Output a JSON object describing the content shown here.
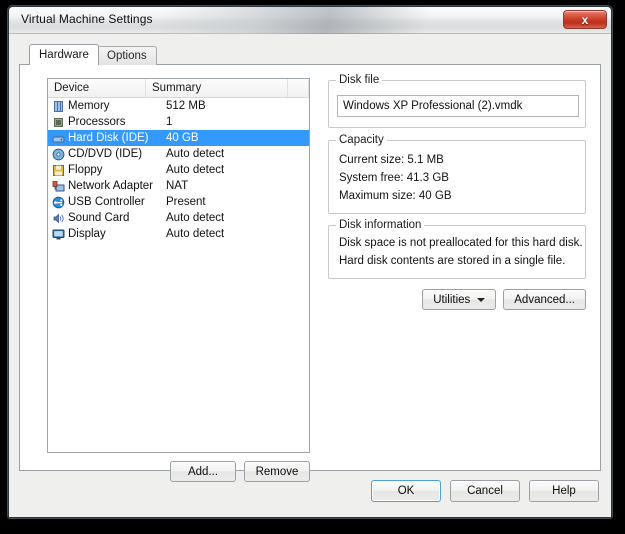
{
  "window": {
    "title": "Virtual Machine Settings",
    "close_label": "x"
  },
  "tabs": [
    {
      "label": "Hardware",
      "active": true
    },
    {
      "label": "Options",
      "active": false
    }
  ],
  "device_list": {
    "columns": [
      "Device",
      "Summary",
      ""
    ],
    "rows": [
      {
        "icon": "memory-icon",
        "device": "Memory",
        "summary": "512 MB",
        "selected": false
      },
      {
        "icon": "processor-icon",
        "device": "Processors",
        "summary": "1",
        "selected": false
      },
      {
        "icon": "hard-disk-icon",
        "device": "Hard Disk (IDE)",
        "summary": "40 GB",
        "selected": true
      },
      {
        "icon": "cd-dvd-icon",
        "device": "CD/DVD (IDE)",
        "summary": "Auto detect",
        "selected": false
      },
      {
        "icon": "floppy-icon",
        "device": "Floppy",
        "summary": "Auto detect",
        "selected": false
      },
      {
        "icon": "network-adapter-icon",
        "device": "Network Adapter",
        "summary": "NAT",
        "selected": false
      },
      {
        "icon": "usb-controller-icon",
        "device": "USB Controller",
        "summary": "Present",
        "selected": false
      },
      {
        "icon": "sound-card-icon",
        "device": "Sound Card",
        "summary": "Auto detect",
        "selected": false
      },
      {
        "icon": "display-icon",
        "device": "Display",
        "summary": "Auto detect",
        "selected": false
      }
    ],
    "add_label": "Add...",
    "remove_label": "Remove"
  },
  "disk_file": {
    "legend": "Disk file",
    "value": "Windows XP Professional (2).vmdk"
  },
  "capacity": {
    "legend": "Capacity",
    "current_size_label": "Current size:",
    "current_size_value": "5.1 MB",
    "system_free_label": "System free:",
    "system_free_value": "41.3 GB",
    "maximum_size_label": "Maximum size:",
    "maximum_size_value": "40 GB"
  },
  "disk_information": {
    "legend": "Disk information",
    "line1": "Disk space is not preallocated for this hard disk.",
    "line2": "Hard disk contents are stored in a single file."
  },
  "disk_actions": {
    "utilities_label": "Utilities",
    "advanced_label": "Advanced..."
  },
  "footer": {
    "ok_label": "OK",
    "cancel_label": "Cancel",
    "help_label": "Help"
  },
  "colors": {
    "selection": "#3399ff",
    "default_button_border": "#4d9fe0",
    "close_button": "#c83a25",
    "window_bg": "#efefed"
  }
}
